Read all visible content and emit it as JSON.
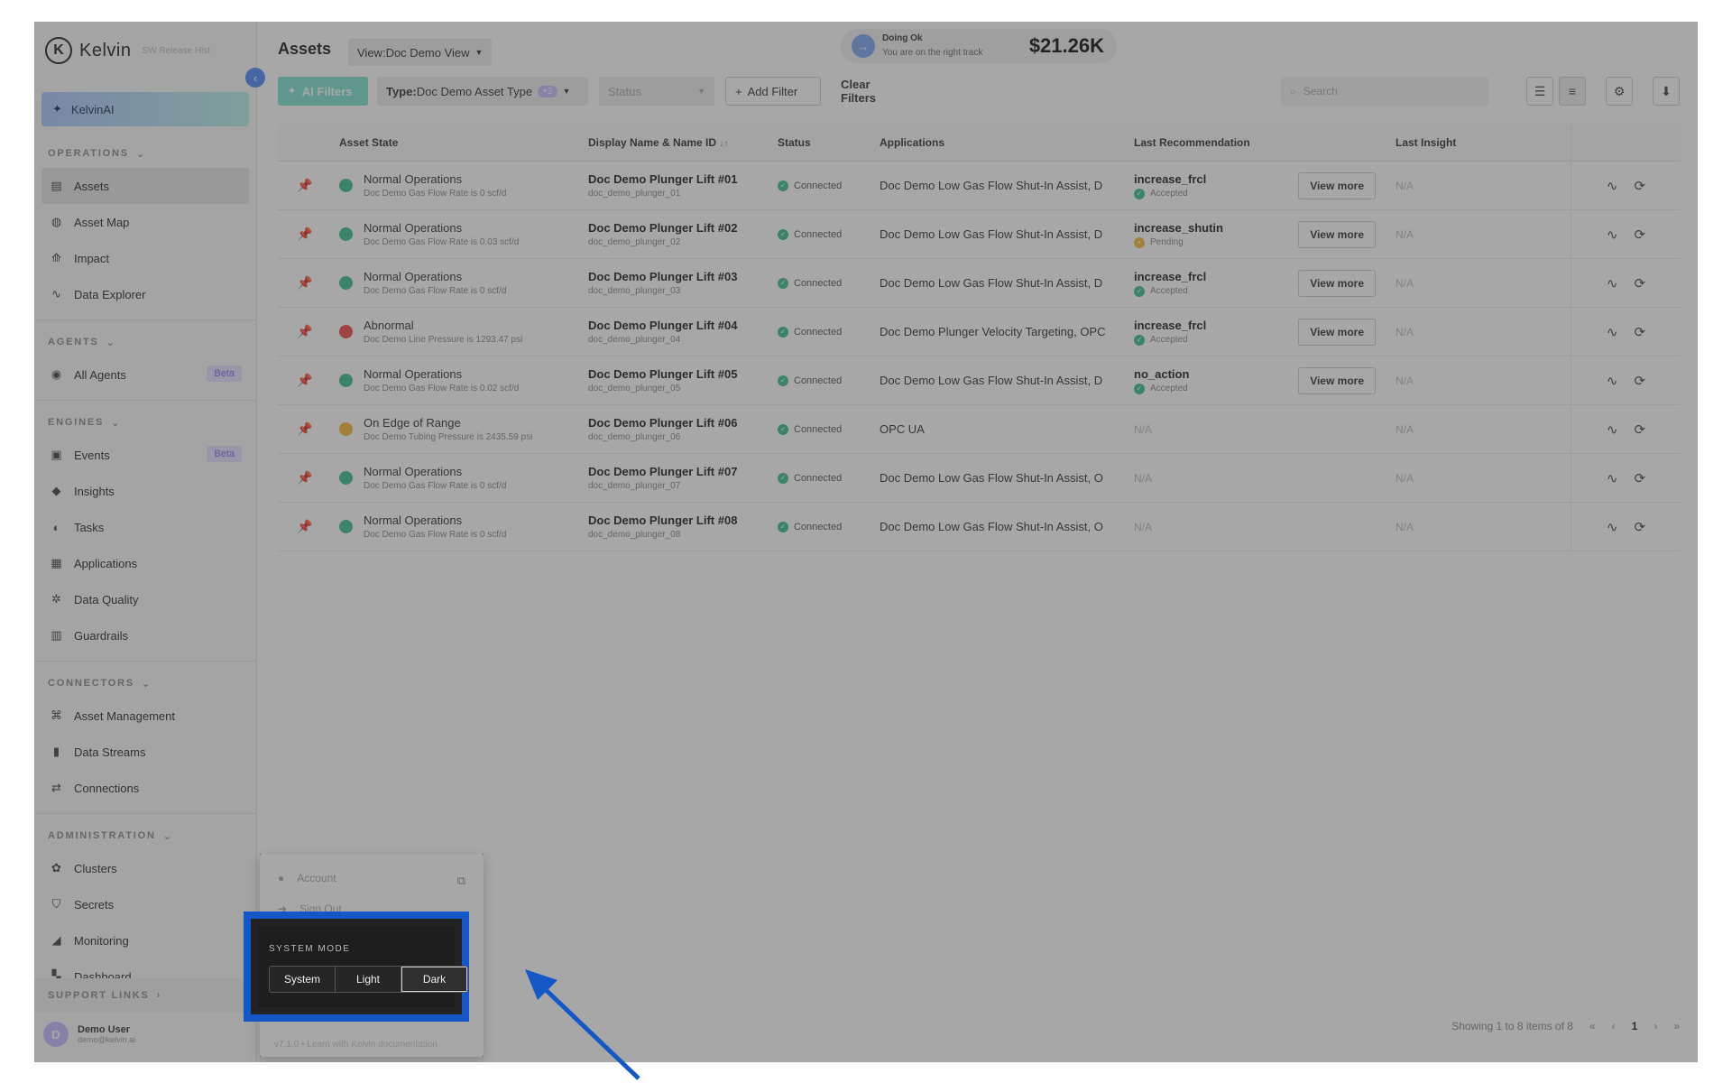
{
  "brand": {
    "name": "Kelvin",
    "logo_letter": "K",
    "subtitle": "SW Release Hist"
  },
  "kelvinai": {
    "label": "KelvinAI"
  },
  "sidebar": {
    "sections": {
      "operations": "OPERATIONS",
      "agents": "AGENTS",
      "engines": "ENGINES",
      "connectors": "CONNECTORS",
      "administration": "ADMINISTRATION",
      "support": "SUPPORT LINKS"
    },
    "items": {
      "assets": "Assets",
      "asset_map": "Asset Map",
      "impact": "Impact",
      "data_explorer": "Data Explorer",
      "all_agents": "All Agents",
      "events": "Events",
      "insights": "Insights",
      "tasks": "Tasks",
      "applications": "Applications",
      "data_quality": "Data Quality",
      "guardrails": "Guardrails",
      "asset_management": "Asset Management",
      "data_streams": "Data Streams",
      "connections": "Connections",
      "clusters": "Clusters",
      "secrets": "Secrets",
      "monitoring": "Monitoring",
      "dashboard": "Dashboard"
    },
    "beta": "Beta"
  },
  "user": {
    "initial": "D",
    "name": "Demo User",
    "email": "demo@kelvin.ai"
  },
  "header": {
    "title": "Assets",
    "view_label": "View:",
    "view_value": "Doc Demo View",
    "status_title": "Doing Ok",
    "status_sub": "You are on the right track",
    "status_value": "$21.26K"
  },
  "toolbar": {
    "ai_filters": "AI Filters",
    "type_label": "Type:",
    "type_value": "Doc Demo Asset Type",
    "type_count": "+2",
    "status": "Status",
    "add_filter": "Add Filter",
    "clear_filters": "Clear Filters",
    "search_placeholder": "Search"
  },
  "table": {
    "headers": {
      "state": "Asset State",
      "name": "Display Name & Name ID",
      "sort": "↓↑",
      "status": "Status",
      "apps": "Applications",
      "rec": "Last Recommendation",
      "insight": "Last Insight"
    },
    "view_more": "View more",
    "na": "N/A",
    "rows": [
      {
        "state": "Normal Operations",
        "detail": "Doc Demo Gas Flow Rate is 0 scf/d",
        "name": "Doc Demo Plunger Lift #01",
        "id": "doc_demo_plunger_01",
        "status": "Connected",
        "apps": "Doc Demo Low Gas Flow Shut-In Assist, D",
        "rec": "increase_frcl",
        "rec_status": "Accepted"
      },
      {
        "state": "Normal Operations",
        "detail": "Doc Demo Gas Flow Rate is 0.03 scf/d",
        "name": "Doc Demo Plunger Lift #02",
        "id": "doc_demo_plunger_02",
        "status": "Connected",
        "apps": "Doc Demo Low Gas Flow Shut-In Assist, D",
        "rec": "increase_shutin",
        "rec_status": "Pending"
      },
      {
        "state": "Normal Operations",
        "detail": "Doc Demo Gas Flow Rate is 0 scf/d",
        "name": "Doc Demo Plunger Lift #03",
        "id": "doc_demo_plunger_03",
        "status": "Connected",
        "apps": "Doc Demo Low Gas Flow Shut-In Assist, D",
        "rec": "increase_frcl",
        "rec_status": "Accepted"
      },
      {
        "state": "Abnormal",
        "detail": "Doc Demo Line Pressure is 1293.47 psi",
        "name": "Doc Demo Plunger Lift #04",
        "id": "doc_demo_plunger_04",
        "status": "Connected",
        "apps": "Doc Demo Plunger Velocity Targeting, OPC",
        "rec": "increase_frcl",
        "rec_status": "Accepted"
      },
      {
        "state": "Normal Operations",
        "detail": "Doc Demo Gas Flow Rate is 0.02 scf/d",
        "name": "Doc Demo Plunger Lift #05",
        "id": "doc_demo_plunger_05",
        "status": "Connected",
        "apps": "Doc Demo Low Gas Flow Shut-In Assist, D",
        "rec": "no_action",
        "rec_status": "Accepted"
      },
      {
        "state": "On Edge of Range",
        "detail": "Doc Demo Tubing Pressure is 2435.59 psi",
        "name": "Doc Demo Plunger Lift #06",
        "id": "doc_demo_plunger_06",
        "status": "Connected",
        "apps": "OPC UA",
        "rec": "",
        "rec_status": ""
      },
      {
        "state": "Normal Operations",
        "detail": "Doc Demo Gas Flow Rate is 0 scf/d",
        "name": "Doc Demo Plunger Lift #07",
        "id": "doc_demo_plunger_07",
        "status": "Connected",
        "apps": "Doc Demo Low Gas Flow Shut-In Assist, O",
        "rec": "",
        "rec_status": ""
      },
      {
        "state": "Normal Operations",
        "detail": "Doc Demo Gas Flow Rate is 0 scf/d",
        "name": "Doc Demo Plunger Lift #08",
        "id": "doc_demo_plunger_08",
        "status": "Connected",
        "apps": "Doc Demo Low Gas Flow Shut-In Assist, O",
        "rec": "",
        "rec_status": ""
      }
    ]
  },
  "state_colors": {
    "Normal Operations": "#3cc08a",
    "Abnormal": "#ee4b4b",
    "On Edge of Range": "#f2b93b"
  },
  "pager": {
    "summary": "Showing 1 to 8 items of 8",
    "current": "1"
  },
  "popup": {
    "account": "Account",
    "sign_out": "Sign Out",
    "version": "v7.1.0  •  Learn with Kelvin documentation",
    "mode_title": "SYSTEM MODE",
    "modes": [
      "System",
      "Light",
      "Dark"
    ],
    "selected": "Dark"
  },
  "colors": {
    "highlight": "#1458c8",
    "accent": "#4f8bf7"
  }
}
